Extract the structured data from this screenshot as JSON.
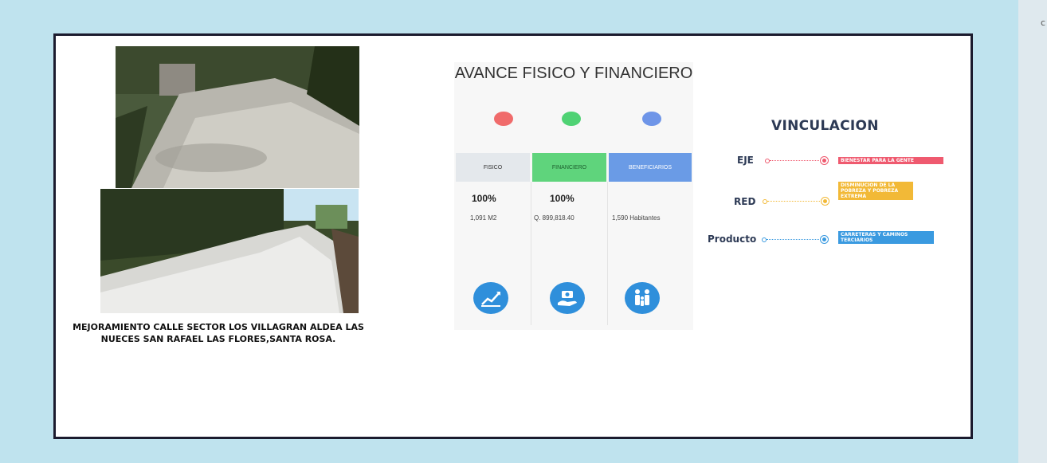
{
  "project_caption": "MEJORAMIENTO CALLE SECTOR LOS VILLAGRAN ALDEA LAS NUECES SAN RAFAEL LAS FLORES,SANTA ROSA.",
  "photos": [
    {
      "icon": "street-photo-top"
    },
    {
      "icon": "street-photo-bottom"
    }
  ],
  "avance": {
    "title": "AVANCE FISICO Y FINANCIERO",
    "indicator_colors": [
      "#f06b6b",
      "#4fd274",
      "#6e95e8"
    ],
    "columns": [
      {
        "header": "FISICO",
        "percent": "100%",
        "value": "1,091 M2",
        "icon": "growth-chart-icon"
      },
      {
        "header": "FINANCIERO",
        "percent": "100%",
        "value": "Q. 899,818.40",
        "icon": "money-hand-icon"
      },
      {
        "header": "BENEFICIARIOS",
        "percent": "",
        "value": "1,590 Habitantes",
        "icon": "family-icon"
      }
    ]
  },
  "vinculacion": {
    "title": "VINCULACION",
    "rows": [
      {
        "label": "EJE",
        "tag": "BIENESTAR PARA LA GENTE",
        "color": "#ef5a6f"
      },
      {
        "label": "RED",
        "tag": "DISMINUCION DE LA POBREZA Y POBREZA EXTREMA",
        "color": "#f2b937"
      },
      {
        "label": "Producto",
        "tag": "CARRETERAS Y CAMINOS TERCIARIOS",
        "color": "#3a9ae0"
      }
    ]
  },
  "edge_char": "c"
}
